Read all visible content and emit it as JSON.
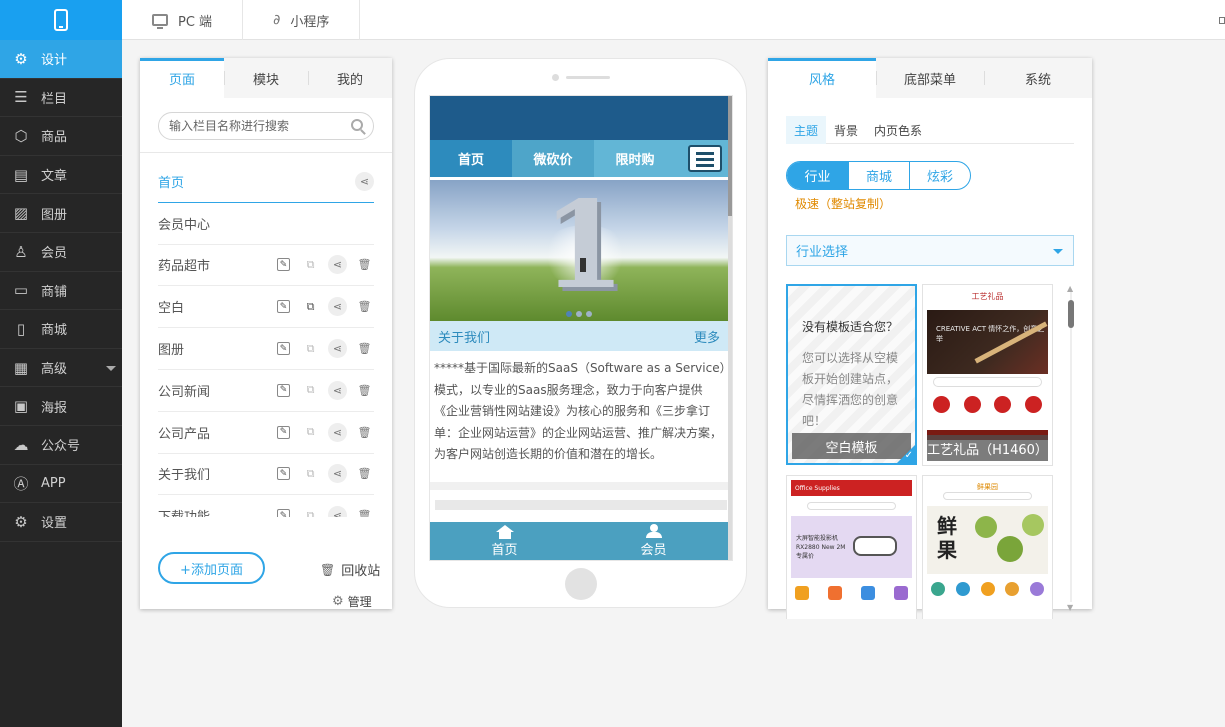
{
  "topbar": {
    "tabs": [
      {
        "label": "PC 端",
        "icon": "monitor-icon"
      },
      {
        "label": "小程序",
        "icon": "mini-program-icon"
      }
    ]
  },
  "sidebar": {
    "items": [
      {
        "label": "设计",
        "icon": "design-icon",
        "active": true
      },
      {
        "label": "栏目",
        "icon": "list-icon"
      },
      {
        "label": "商品",
        "icon": "box-icon"
      },
      {
        "label": "文章",
        "icon": "article-icon"
      },
      {
        "label": "图册",
        "icon": "image-icon"
      },
      {
        "label": "会员",
        "icon": "user-icon"
      },
      {
        "label": "商铺",
        "icon": "shop-icon"
      },
      {
        "label": "商城",
        "icon": "clipboard-icon"
      },
      {
        "label": "高级",
        "icon": "grid-icon"
      },
      {
        "label": "海报",
        "icon": "poster-icon"
      },
      {
        "label": "公众号",
        "icon": "wechat-icon"
      },
      {
        "label": "APP",
        "icon": "app-icon"
      },
      {
        "label": "设置",
        "icon": "gear-icon"
      }
    ]
  },
  "left_panel": {
    "tabs": [
      "页面",
      "模块",
      "我的"
    ],
    "search_placeholder": "输入栏目名称进行搜索",
    "pages": [
      "首页",
      "会员中心",
      "药品超市",
      "空白",
      "图册",
      "公司新闻",
      "公司产品",
      "关于我们",
      "下载功能"
    ],
    "add_page_label": "+添加页面",
    "recycle_label": "回收站",
    "manage_label": "管理"
  },
  "phone": {
    "nav": [
      "首页",
      "微砍价",
      "限时购"
    ],
    "banner_number": "1",
    "about_title": "关于我们",
    "about_more": "更多",
    "about_text": "*****基于国际最新的SaaS（Software as a Service）模式，以专业的Saas服务理念，致力于向客户提供《企业营销性网站建设》为核心的服务和《三步拿订单：企业网站运营》的企业网站运营、推广解决方案，为客户网站创造长期的价值和潜在的增长。",
    "footer": [
      "首页",
      "会员"
    ]
  },
  "right_panel": {
    "tabs": [
      "风格",
      "底部菜单",
      "系统"
    ],
    "subtabs": [
      "主题",
      "背景",
      "内页色系"
    ],
    "segments": [
      "行业",
      "商城",
      "炫彩"
    ],
    "fast_link": "极速（整站复制）",
    "industry_select": "行业选择",
    "blank_template": {
      "question": "没有模板适合您？",
      "desc": "您可以选择从空模板开始创建站点，尽情挥洒您的创意吧！",
      "label": "空白模板"
    },
    "gift_template": {
      "label": "工艺礼品（H1460）",
      "brand": "工艺礼品",
      "banner_text": "CREATIVE ACT 情怀之作，创意之举"
    },
    "office_template": {
      "header": "Office Supplies",
      "banner_text": "大屏智能投影机 RX2880 New 2M 专属价"
    },
    "fruit_template": {
      "brand": "鲜果园",
      "banner_char": "鲜果"
    }
  }
}
